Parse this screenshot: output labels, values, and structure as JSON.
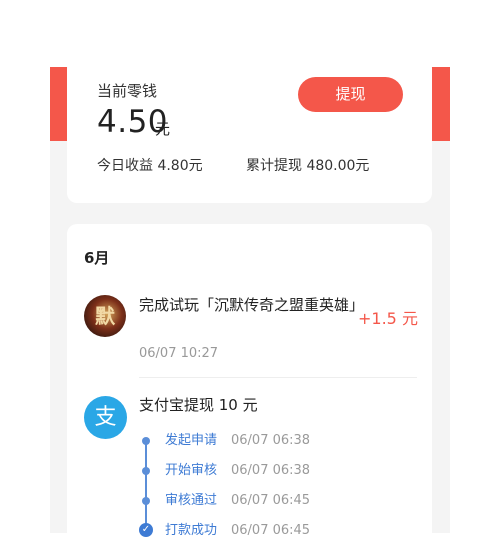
{
  "wallet": {
    "balance_label": "当前零钱",
    "balance_value": "4.50",
    "balance_unit": "元",
    "withdraw_button": "提现",
    "today_income": "今日收益 4.80元",
    "total_withdrawn": "累计提现 480.00元"
  },
  "records": {
    "month": "6月",
    "trial": {
      "title": "完成试玩「沉默传奇之盟重英雄」",
      "time": "06/07 10:27",
      "reward": "+1.5 元",
      "icon": "game-avatar"
    },
    "withdrawal": {
      "title": "支付宝提现 10 元",
      "icon_glyph": "支",
      "icon": "alipay-icon",
      "steps": [
        {
          "name": "发起申请",
          "time": "06/07 06:38"
        },
        {
          "name": "开始审核",
          "time": "06/07 06:38"
        },
        {
          "name": "审核通过",
          "time": "06/07 06:45"
        },
        {
          "name": "打款成功",
          "time": "06/07 06:45"
        }
      ]
    }
  },
  "colors": {
    "accent": "#f4574a",
    "timeline": "#3e7bd4",
    "alipay": "#2aa7e6"
  }
}
